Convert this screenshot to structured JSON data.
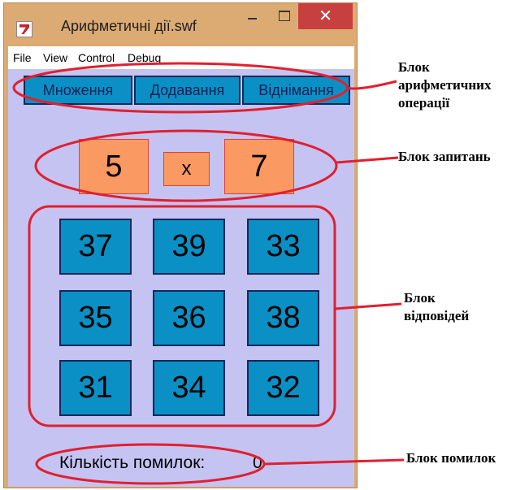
{
  "window": {
    "title": "Арифметичні дії.swf",
    "close_glyph": "✕"
  },
  "menu": [
    "File",
    "View",
    "Control",
    "Debug"
  ],
  "operations": [
    "Множення",
    "Додавання",
    "Віднімання"
  ],
  "question": {
    "left": "5",
    "operator": "x",
    "right": "7"
  },
  "answers": [
    "37",
    "39",
    "33",
    "35",
    "36",
    "38",
    "31",
    "34",
    "32"
  ],
  "errors": {
    "label": "Кількість помилок:",
    "value": "0"
  },
  "annotations": {
    "operations_block": [
      "Блок",
      "арифметичних",
      "операції"
    ],
    "question_block": "Блок запитань",
    "answers_block": [
      "Блок",
      "відповідей"
    ],
    "errors_block": "Блок помилок"
  },
  "colors": {
    "window_frame": "#dcab73",
    "stage_background": "#c5c3f2",
    "tile_blue": "#0a90c5",
    "question_orange": "#fb9962",
    "annotation_red": "#e0202f",
    "close_red": "#c7403f"
  }
}
